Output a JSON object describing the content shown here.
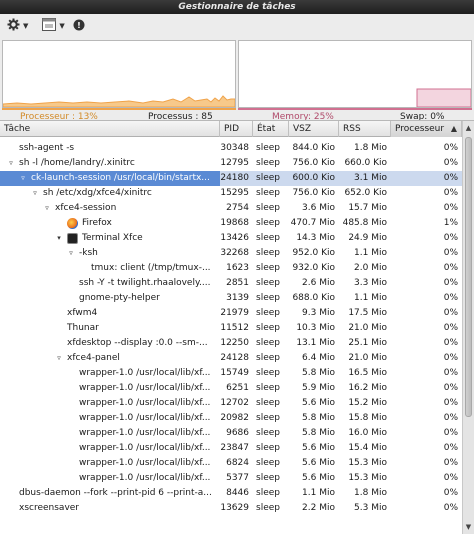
{
  "window": {
    "title": "Gestionnaire de tâches"
  },
  "toolbar": {
    "icons": [
      "gear-icon",
      "chevron-down-icon",
      "window-icon",
      "chevron-down-icon",
      "info-icon"
    ]
  },
  "stats": {
    "cpu_label": "Processeur : 13%",
    "processes_label": "Processus : 85",
    "memory_label": "Memory: 25%",
    "swap_label": "Swap: 0%",
    "cpu_percent": 13,
    "memory_percent": 25,
    "swap_percent": 0,
    "colors": {
      "cpu": "#f0a34a",
      "memory": "#d07090"
    }
  },
  "table": {
    "headers": {
      "task": "Tâche",
      "pid": "PID",
      "state": "État",
      "vsz": "VSZ",
      "rss": "RSS",
      "cpu": "Processeur"
    },
    "sort_indicator": "▲",
    "rows": [
      {
        "depth": 1,
        "expander": "",
        "icon": "",
        "task": "",
        "pid": "",
        "state": "",
        "vsz": "",
        "rss": "",
        "cpu": ""
      },
      {
        "depth": 1,
        "expander": "",
        "icon": "",
        "task": "ssh-agent -s",
        "pid": "30348",
        "state": "sleep",
        "vsz": "844.0 Kio",
        "rss": "1.8 Mio",
        "cpu": "0%"
      },
      {
        "depth": 1,
        "expander": "▿",
        "icon": "",
        "task": "sh -l /home/landry/.xinitrc",
        "pid": "12795",
        "state": "sleep",
        "vsz": "756.0 Kio",
        "rss": "660.0 Kio",
        "cpu": "0%"
      },
      {
        "depth": 2,
        "expander": "▿",
        "icon": "",
        "task": "ck-launch-session /usr/local/bin/startx...",
        "pid": "24180",
        "state": "sleep",
        "vsz": "600.0 Kio",
        "rss": "3.1 Mio",
        "cpu": "0%",
        "selected": true
      },
      {
        "depth": 3,
        "expander": "▿",
        "icon": "",
        "task": "sh /etc/xdg/xfce4/xinitrc",
        "pid": "15295",
        "state": "sleep",
        "vsz": "756.0 Kio",
        "rss": "652.0 Kio",
        "cpu": "0%"
      },
      {
        "depth": 4,
        "expander": "▿",
        "icon": "",
        "task": "xfce4-session",
        "pid": "2754",
        "state": "sleep",
        "vsz": "3.6 Mio",
        "rss": "15.7 Mio",
        "cpu": "0%"
      },
      {
        "depth": 5,
        "expander": "",
        "icon": "firefox",
        "task": "Firefox",
        "pid": "19868",
        "state": "sleep",
        "vsz": "470.7 Mio",
        "rss": "485.8 Mio",
        "cpu": "1%"
      },
      {
        "depth": 5,
        "expander": "▾",
        "icon": "terminal",
        "task": "Terminal Xfce",
        "pid": "13426",
        "state": "sleep",
        "vsz": "14.3 Mio",
        "rss": "24.9 Mio",
        "cpu": "0%"
      },
      {
        "depth": 6,
        "expander": "▿",
        "icon": "",
        "task": "-ksh",
        "pid": "32268",
        "state": "sleep",
        "vsz": "952.0 Kio",
        "rss": "1.1 Mio",
        "cpu": "0%"
      },
      {
        "depth": 7,
        "expander": "",
        "icon": "",
        "task": "tmux: client (/tmp/tmux-...",
        "pid": "1623",
        "state": "sleep",
        "vsz": "932.0 Kio",
        "rss": "2.0 Mio",
        "cpu": "0%"
      },
      {
        "depth": 6,
        "expander": "",
        "icon": "",
        "task": "ssh -Y -t twilight.rhaalovely....",
        "pid": "2851",
        "state": "sleep",
        "vsz": "2.6 Mio",
        "rss": "3.3 Mio",
        "cpu": "0%"
      },
      {
        "depth": 6,
        "expander": "",
        "icon": "",
        "task": "gnome-pty-helper",
        "pid": "3139",
        "state": "sleep",
        "vsz": "688.0 Kio",
        "rss": "1.1 Mio",
        "cpu": "0%"
      },
      {
        "depth": 5,
        "expander": "",
        "icon": "",
        "task": "xfwm4",
        "pid": "21979",
        "state": "sleep",
        "vsz": "9.3 Mio",
        "rss": "17.5 Mio",
        "cpu": "0%"
      },
      {
        "depth": 5,
        "expander": "",
        "icon": "",
        "task": "Thunar",
        "pid": "11512",
        "state": "sleep",
        "vsz": "10.3 Mio",
        "rss": "21.0 Mio",
        "cpu": "0%"
      },
      {
        "depth": 5,
        "expander": "",
        "icon": "",
        "task": "xfdesktop --display :0.0 --sm-...",
        "pid": "12250",
        "state": "sleep",
        "vsz": "13.1 Mio",
        "rss": "25.1 Mio",
        "cpu": "0%"
      },
      {
        "depth": 5,
        "expander": "▿",
        "icon": "",
        "task": "xfce4-panel",
        "pid": "24128",
        "state": "sleep",
        "vsz": "6.4 Mio",
        "rss": "21.0 Mio",
        "cpu": "0%"
      },
      {
        "depth": 6,
        "expander": "",
        "icon": "",
        "task": "wrapper-1.0 /usr/local/lib/xf...",
        "pid": "15749",
        "state": "sleep",
        "vsz": "5.8 Mio",
        "rss": "16.5 Mio",
        "cpu": "0%"
      },
      {
        "depth": 6,
        "expander": "",
        "icon": "",
        "task": "wrapper-1.0 /usr/local/lib/xf...",
        "pid": "6251",
        "state": "sleep",
        "vsz": "5.9 Mio",
        "rss": "16.2 Mio",
        "cpu": "0%"
      },
      {
        "depth": 6,
        "expander": "",
        "icon": "",
        "task": "wrapper-1.0 /usr/local/lib/xf...",
        "pid": "12702",
        "state": "sleep",
        "vsz": "5.6 Mio",
        "rss": "15.2 Mio",
        "cpu": "0%"
      },
      {
        "depth": 6,
        "expander": "",
        "icon": "",
        "task": "wrapper-1.0 /usr/local/lib/xf...",
        "pid": "20982",
        "state": "sleep",
        "vsz": "5.8 Mio",
        "rss": "15.8 Mio",
        "cpu": "0%"
      },
      {
        "depth": 6,
        "expander": "",
        "icon": "",
        "task": "wrapper-1.0 /usr/local/lib/xf...",
        "pid": "9686",
        "state": "sleep",
        "vsz": "5.8 Mio",
        "rss": "16.0 Mio",
        "cpu": "0%"
      },
      {
        "depth": 6,
        "expander": "",
        "icon": "",
        "task": "wrapper-1.0 /usr/local/lib/xf...",
        "pid": "23847",
        "state": "sleep",
        "vsz": "5.6 Mio",
        "rss": "15.4 Mio",
        "cpu": "0%"
      },
      {
        "depth": 6,
        "expander": "",
        "icon": "",
        "task": "wrapper-1.0 /usr/local/lib/xf...",
        "pid": "6824",
        "state": "sleep",
        "vsz": "5.6 Mio",
        "rss": "15.3 Mio",
        "cpu": "0%"
      },
      {
        "depth": 6,
        "expander": "",
        "icon": "",
        "task": "wrapper-1.0 /usr/local/lib/xf...",
        "pid": "5377",
        "state": "sleep",
        "vsz": "5.6 Mio",
        "rss": "15.3 Mio",
        "cpu": "0%"
      },
      {
        "depth": 1,
        "expander": "",
        "icon": "",
        "task": "dbus-daemon --fork --print-pid 6 --print-a...",
        "pid": "8446",
        "state": "sleep",
        "vsz": "1.1 Mio",
        "rss": "1.8 Mio",
        "cpu": "0%"
      },
      {
        "depth": 1,
        "expander": "",
        "icon": "",
        "task": "xscreensaver",
        "pid": "13629",
        "state": "sleep",
        "vsz": "2.2 Mio",
        "rss": "5.3 Mio",
        "cpu": "0%"
      }
    ]
  }
}
